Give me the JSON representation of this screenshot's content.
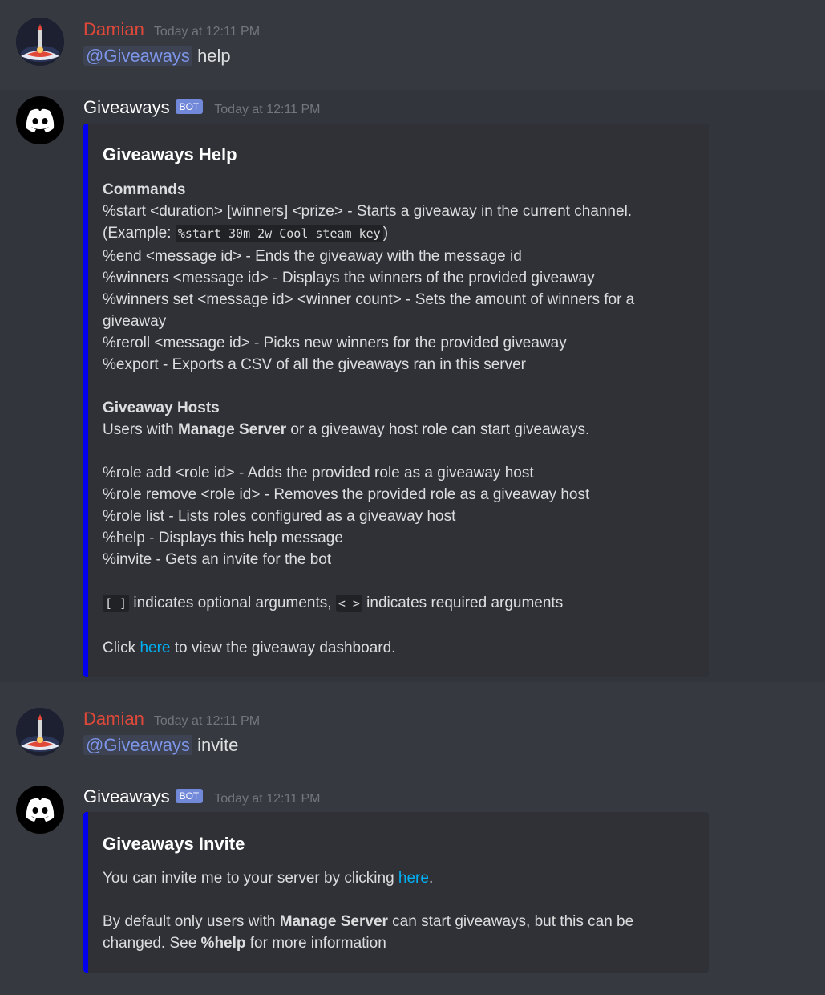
{
  "messages": [
    {
      "author": "Damian",
      "timestamp": "Today at 12:11 PM",
      "mention": "@Giveaways",
      "text": "help"
    },
    {
      "author": "Giveaways",
      "bot_tag": "BOT",
      "timestamp": "Today at 12:11 PM"
    },
    {
      "author": "Damian",
      "timestamp": "Today at 12:11 PM",
      "mention": "@Giveaways",
      "text": "invite"
    },
    {
      "author": "Giveaways",
      "bot_tag": "BOT",
      "timestamp": "Today at 12:11 PM"
    }
  ],
  "help_embed": {
    "title": "Giveaways Help",
    "commands_heading": "Commands",
    "cmd_start": "%start <duration> [winners] <prize> - Starts a giveaway in the current channel.",
    "example_prefix": "(Example: ",
    "example_code": "%start 30m 2w Cool steam key",
    "example_suffix": ")",
    "cmd_end": "%end <message id> - Ends the giveaway with the message id",
    "cmd_winners": "%winners <message id> - Displays the winners of the provided giveaway",
    "cmd_winners_set_1": "%winners set <message id> <winner count> - Sets the amount of winners for a",
    "cmd_winners_set_2": "giveaway",
    "cmd_reroll": "%reroll <message id> - Picks new winners for the provided giveaway",
    "cmd_export": "%export - Exports a CSV of all the giveaways ran in this server",
    "hosts_heading": "Giveaway Hosts",
    "hosts_prefix": "Users with ",
    "hosts_bold": "Manage Server",
    "hosts_suffix": " or a giveaway host role can start giveaways.",
    "cmd_role_add": "%role add <role id> - Adds the provided role as a giveaway host",
    "cmd_role_remove": "%role remove <role id> - Removes the provided role as a giveaway host",
    "cmd_role_list": "%role list - Lists roles configured as a giveaway host",
    "cmd_help": "%help - Displays this help message",
    "cmd_invite": "%invite - Gets an invite for the bot",
    "optional_code": "[ ]",
    "optional_text": " indicates optional arguments, ",
    "required_code": "< >",
    "required_text": " indicates required arguments",
    "click_prefix": "Click ",
    "click_link": "here",
    "click_suffix": " to view the giveaway dashboard."
  },
  "invite_embed": {
    "title": "Giveaways Invite",
    "line1_prefix": "You can invite me to your server by clicking ",
    "line1_link": "here",
    "line1_suffix": ".",
    "line2_prefix": "By default only users with ",
    "line2_bold": "Manage Server",
    "line2_suffix": " can start giveaways, but this can be",
    "line3_prefix": "changed. See ",
    "line3_bold": "%help",
    "line3_suffix": " for more information"
  },
  "colors": {
    "background": "#36393f",
    "embed_bg": "#2f3136",
    "embed_border": "#0000ee",
    "username_user": "#e0483a",
    "link": "#00b0f4",
    "mention": "#7d95e8",
    "bot_tag": "#7289da"
  },
  "icons": {
    "user_avatar": "rocket-launch-icon",
    "bot_avatar": "discord-logo-icon"
  }
}
